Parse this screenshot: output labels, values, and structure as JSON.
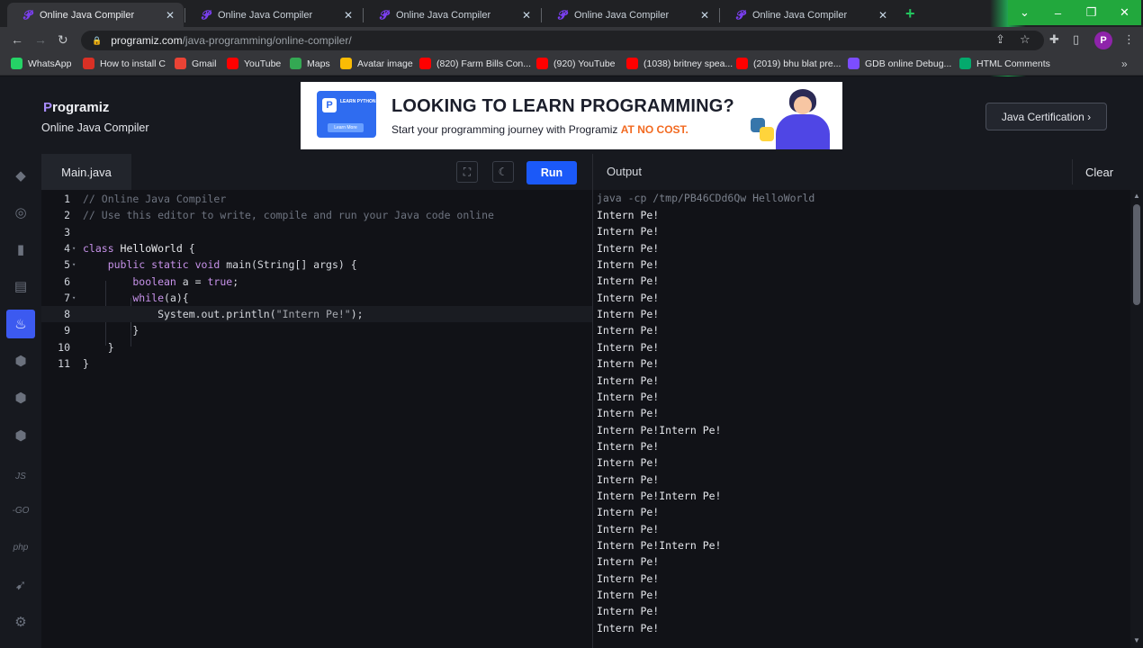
{
  "browser": {
    "tabs": [
      {
        "title": "Online Java Compiler",
        "active": true
      },
      {
        "title": "Online Java Compiler",
        "active": false
      },
      {
        "title": "Online Java Compiler",
        "active": false
      },
      {
        "title": "Online Java Compiler",
        "active": false
      },
      {
        "title": "Online Java Compiler",
        "active": false
      }
    ],
    "url_host": "programiz.com",
    "url_path": "/java-programming/online-compiler/",
    "profile_initial": "P",
    "bookmarks": [
      {
        "label": "WhatsApp",
        "color": "#25d366"
      },
      {
        "label": "How to install C",
        "color": "#d93025"
      },
      {
        "label": "Gmail",
        "color": "#ea4335"
      },
      {
        "label": "YouTube",
        "color": "#ff0000"
      },
      {
        "label": "Maps",
        "color": "#34a853"
      },
      {
        "label": "Avatar image",
        "color": "#fbbc04"
      },
      {
        "label": "(820) Farm Bills Con...",
        "color": "#ff0000"
      },
      {
        "label": "(920) YouTube",
        "color": "#ff0000"
      },
      {
        "label": "(1038) britney spea...",
        "color": "#ff0000"
      },
      {
        "label": "(2019) bhu blat pre...",
        "color": "#ff0000"
      },
      {
        "label": "GDB online Debug...",
        "color": "#7c4dff"
      },
      {
        "label": "HTML Comments",
        "color": "#04aa6d"
      }
    ]
  },
  "site": {
    "logo": "rogramiz",
    "logo_initial": "P",
    "subtitle": "Online Java Compiler",
    "banner_headline": "LOOKING TO LEARN PROGRAMMING?",
    "banner_sub": "Start your programming journey with Programiz ",
    "banner_highlight": "AT NO COST.",
    "banner_card_label": "LEARN PYTHON",
    "banner_card_button": "Learn More",
    "cert_button": "Java Certification ›"
  },
  "rail": [
    "python",
    "r",
    "sql",
    "html",
    "java",
    "c",
    "cpp",
    "csharp",
    "JS",
    "GO",
    "php",
    "swift",
    "rust"
  ],
  "editor": {
    "file_tab": "Main.java",
    "run_label": "Run",
    "lines": [
      {
        "n": "1",
        "segments": [
          {
            "t": "// Online Java Compiler",
            "c": "cm"
          }
        ]
      },
      {
        "n": "2",
        "segments": [
          {
            "t": "// Use this editor to write, compile and run your Java code online",
            "c": "cm"
          }
        ]
      },
      {
        "n": "3",
        "segments": []
      },
      {
        "n": "4",
        "fold": true,
        "segments": [
          {
            "t": "class ",
            "c": "kw"
          },
          {
            "t": "HelloWorld",
            "c": "cls"
          },
          {
            "t": " {",
            "c": "fn"
          }
        ]
      },
      {
        "n": "5",
        "fold": true,
        "segments": [
          {
            "t": "    public static void ",
            "c": "kw"
          },
          {
            "t": "main(String[] args) {",
            "c": "fn"
          }
        ]
      },
      {
        "n": "6",
        "segments": [
          {
            "t": "        boolean ",
            "c": "kw"
          },
          {
            "t": "a = ",
            "c": "fn"
          },
          {
            "t": "true",
            "c": "val"
          },
          {
            "t": ";",
            "c": "fn"
          }
        ]
      },
      {
        "n": "7",
        "fold": true,
        "segments": [
          {
            "t": "        while",
            "c": "kw"
          },
          {
            "t": "(a){",
            "c": "fn"
          }
        ]
      },
      {
        "n": "8",
        "cur": true,
        "segments": [
          {
            "t": "            System.out.println(",
            "c": "fn"
          },
          {
            "t": "\"Intern Pe!\"",
            "c": "str"
          },
          {
            "t": ");",
            "c": "fn"
          }
        ]
      },
      {
        "n": "9",
        "segments": [
          {
            "t": "        }",
            "c": "fn"
          }
        ]
      },
      {
        "n": "10",
        "segments": [
          {
            "t": "    }",
            "c": "fn"
          }
        ]
      },
      {
        "n": "11",
        "segments": [
          {
            "t": "}",
            "c": "fn"
          }
        ]
      }
    ]
  },
  "output": {
    "title": "Output",
    "clear_label": "Clear",
    "command": "java -cp /tmp/PB46CDd6Qw HelloWorld",
    "lines": [
      "Intern Pe!",
      "Intern Pe!",
      "Intern Pe!",
      "Intern Pe!",
      "Intern Pe!",
      "Intern Pe!",
      "Intern Pe!",
      "Intern Pe!",
      "Intern Pe!",
      "Intern Pe!",
      "Intern Pe!",
      "Intern Pe!",
      "Intern Pe!",
      "Intern Pe!Intern Pe!",
      "Intern Pe!",
      "Intern Pe!",
      "Intern Pe!",
      "Intern Pe!Intern Pe!",
      "Intern Pe!",
      "Intern Pe!",
      "Intern Pe!Intern Pe!",
      "Intern Pe!",
      "Intern Pe!",
      "Intern Pe!",
      "Intern Pe!",
      "Intern Pe!"
    ]
  }
}
